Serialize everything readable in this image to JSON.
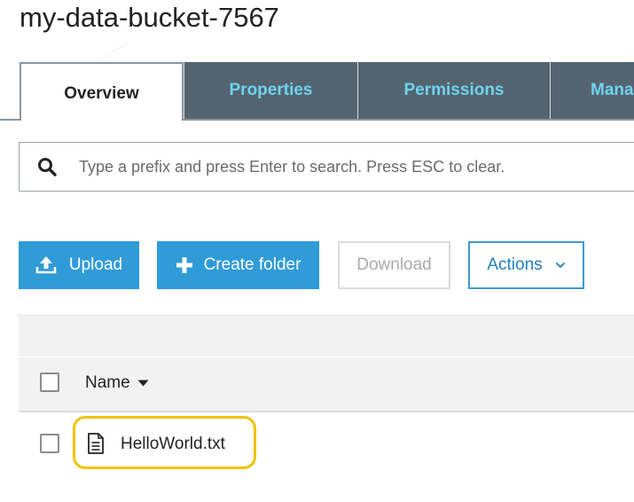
{
  "bucket": {
    "title": "my-data-bucket-7567"
  },
  "tabs": [
    {
      "label": "Overview",
      "active": true
    },
    {
      "label": "Properties",
      "active": false
    },
    {
      "label": "Permissions",
      "active": false
    },
    {
      "label": "Management",
      "active": false
    }
  ],
  "search": {
    "placeholder": "Type a prefix and press Enter to search. Press ESC to clear.",
    "value": "",
    "icon": "search-icon"
  },
  "toolbar": {
    "upload_label": "Upload",
    "upload_icon": "upload-icon",
    "create_folder_label": "Create folder",
    "create_folder_icon": "plus-icon",
    "download_label": "Download",
    "actions_label": "Actions",
    "actions_icon": "chevron-down-icon"
  },
  "table": {
    "columns": [
      {
        "label": "Name",
        "sort": "descending"
      }
    ],
    "rows": [
      {
        "name": "HelloWorld.txt",
        "icon": "file-text-icon",
        "selected": false,
        "highlighted": true
      }
    ]
  },
  "colors": {
    "primary_button": "#2f9bd7",
    "tab_dark": "#546470",
    "tab_text": "#6fd3f0",
    "highlight": "#f2c200"
  }
}
